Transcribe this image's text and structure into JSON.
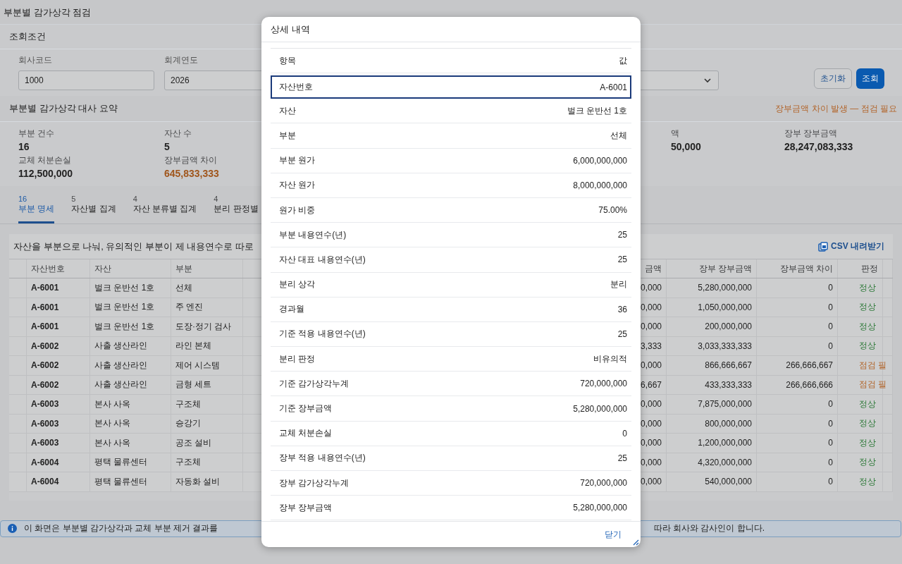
{
  "page_title": "부분별 감가상각 점검",
  "filters": {
    "title": "조회조건",
    "fields": [
      {
        "kind": "text",
        "label": "회사코드",
        "value": "1000"
      },
      {
        "kind": "text",
        "label": "회계연도",
        "value": "2026"
      },
      {
        "kind": "select"
      }
    ],
    "buttons": [
      {
        "kind": "secondary",
        "label": "초기화"
      },
      {
        "kind": "primary",
        "label": "조회"
      }
    ]
  },
  "summary": {
    "title": "부분별 감가상각 대사 요약",
    "warning": "장부금액 차이 발생 — 점검 필요",
    "stats_left": [
      {
        "label": "부분 건수",
        "value": "16",
        "alert": false
      },
      {
        "label": "자산 수",
        "value": "5",
        "alert": false
      },
      {
        "label": "교체 처분손실",
        "value": "112,500,000",
        "alert": false
      },
      {
        "label": "장부금액 차이",
        "value": "645,833,333",
        "alert": true
      }
    ],
    "stats_right": [
      {
        "label": "액",
        "value": "50,000",
        "alert": false
      },
      {
        "label": "장부 장부금액",
        "value": "28,247,083,333",
        "alert": false
      }
    ]
  },
  "tabs": [
    {
      "count": "16",
      "label": "부분 명세",
      "selected": true
    },
    {
      "count": "5",
      "label": "자산별 집계",
      "selected": false
    },
    {
      "count": "4",
      "label": "자산 분류별 집계",
      "selected": false
    },
    {
      "count": "4",
      "label": "분리 판정별",
      "selected": false
    }
  ],
  "table": {
    "description": "자산을 부분으로 나눠, 유의적인 부분이 제 내용연수로 따로",
    "csv_button": "CSV 내려받기",
    "columns_left": [
      "자산번호",
      "자산",
      "부분"
    ],
    "columns_right": [
      "금액",
      "장부 장부금액",
      "장부금액 차이",
      "판정"
    ],
    "rows": [
      {
        "asset_no": "A-6001",
        "asset": "벌크 운반선 1호",
        "part": "선체",
        "column_5": "0,000",
        "book_value": "5,280,000,000",
        "difference": "0",
        "verdict": "정상",
        "color": "#2f7a3a"
      },
      {
        "asset_no": "A-6001",
        "asset": "벌크 운반선 1호",
        "part": "주 엔진",
        "column_5": "0,000",
        "book_value": "1,050,000,000",
        "difference": "0",
        "verdict": "정상",
        "color": "#2f7a3a"
      },
      {
        "asset_no": "A-6001",
        "asset": "벌크 운반선 1호",
        "part": "도장·정기 검사",
        "column_5": "0,000",
        "book_value": "200,000,000",
        "difference": "0",
        "verdict": "정상",
        "color": "#2f7a3a"
      },
      {
        "asset_no": "A-6002",
        "asset": "사출 생산라인",
        "part": "라인 본체",
        "column_5": "3,333",
        "book_value": "3,033,333,333",
        "difference": "0",
        "verdict": "정상",
        "color": "#2f7a3a"
      },
      {
        "asset_no": "A-6002",
        "asset": "사출 생산라인",
        "part": "제어 시스템",
        "column_5": "0,000",
        "book_value": "866,666,667",
        "difference": "266,666,667",
        "verdict": "점검 필",
        "color": "#b2652b"
      },
      {
        "asset_no": "A-6002",
        "asset": "사출 생산라인",
        "part": "금형 세트",
        "column_5": "6,667",
        "book_value": "433,333,333",
        "difference": "266,666,666",
        "verdict": "점검 필",
        "color": "#b2652b"
      },
      {
        "asset_no": "A-6003",
        "asset": "본사 사옥",
        "part": "구조체",
        "column_5": "0,000",
        "book_value": "7,875,000,000",
        "difference": "0",
        "verdict": "정상",
        "color": "#2f7a3a"
      },
      {
        "asset_no": "A-6003",
        "asset": "본사 사옥",
        "part": "승강기",
        "column_5": "0,000",
        "book_value": "800,000,000",
        "difference": "0",
        "verdict": "정상",
        "color": "#2f7a3a"
      },
      {
        "asset_no": "A-6003",
        "asset": "본사 사옥",
        "part": "공조 설비",
        "column_5": "0,000",
        "book_value": "1,200,000,000",
        "difference": "0",
        "verdict": "정상",
        "color": "#2f7a3a"
      },
      {
        "asset_no": "A-6004",
        "asset": "평택 물류센터",
        "part": "구조체",
        "column_5": "0,000",
        "book_value": "4,320,000,000",
        "difference": "0",
        "verdict": "정상",
        "color": "#2f7a3a"
      },
      {
        "asset_no": "A-6004",
        "asset": "평택 물류센터",
        "part": "자동화 설비",
        "column_5": "0,000",
        "book_value": "540,000,000",
        "difference": "0",
        "verdict": "정상",
        "color": "#2f7a3a"
      }
    ]
  },
  "info_bar": {
    "text_left": "이 화면은 부분별 감가상각과 교체 부분 제거 결과를",
    "text_right": "따라 회사와 감사인이 합니다."
  },
  "dialog": {
    "title": "상세 내역",
    "header": {
      "item": "항목",
      "value": "값"
    },
    "rows": [
      {
        "label": "자산번호",
        "value": "A-6001",
        "selected": true
      },
      {
        "label": "자산",
        "value": "벌크 운반선 1호",
        "selected": false
      },
      {
        "label": "부분",
        "value": "선체",
        "selected": false
      },
      {
        "label": "부분 원가",
        "value": "6,000,000,000",
        "selected": false
      },
      {
        "label": "자산 원가",
        "value": "8,000,000,000",
        "selected": false
      },
      {
        "label": "원가 비중",
        "value": "75.00%",
        "selected": false
      },
      {
        "label": "부분 내용연수(년)",
        "value": "25",
        "selected": false
      },
      {
        "label": "자산 대표 내용연수(년)",
        "value": "25",
        "selected": false
      },
      {
        "label": "분리 상각",
        "value": "분리",
        "selected": false
      },
      {
        "label": "경과월",
        "value": "36",
        "selected": false
      },
      {
        "label": "기준 적용 내용연수(년)",
        "value": "25",
        "selected": false
      },
      {
        "label": "분리 판정",
        "value": "비유의적",
        "selected": false
      },
      {
        "label": "기준 감가상각누계",
        "value": "720,000,000",
        "selected": false
      },
      {
        "label": "기준 장부금액",
        "value": "5,280,000,000",
        "selected": false
      },
      {
        "label": "교체 처분손실",
        "value": "0",
        "selected": false
      },
      {
        "label": "장부 적용 내용연수(년)",
        "value": "25",
        "selected": false
      },
      {
        "label": "장부 감가상각누계",
        "value": "720,000,000",
        "selected": false
      },
      {
        "label": "장부 장부금액",
        "value": "5,280,000,000",
        "selected": false
      }
    ],
    "close_label": "닫기"
  }
}
